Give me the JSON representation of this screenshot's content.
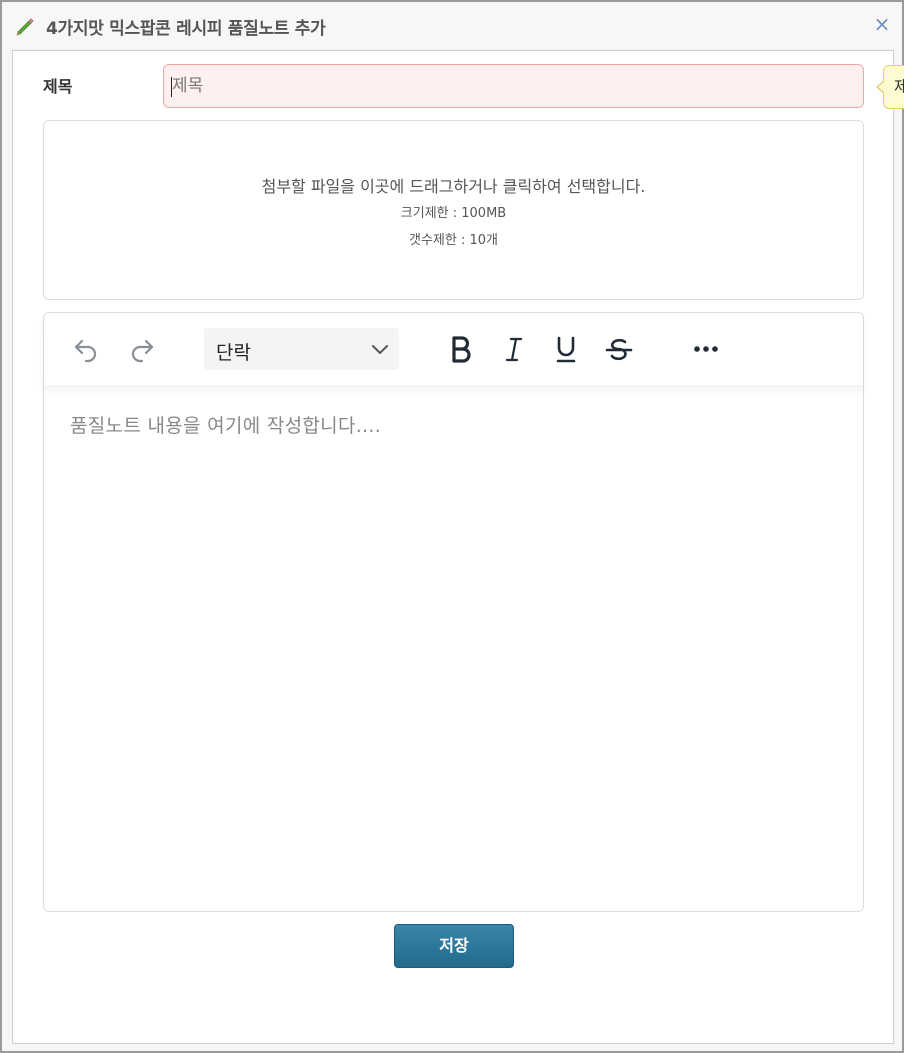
{
  "dialog": {
    "title": "4가지맛 믹스팝콘 레시피 품질노트 추가",
    "close_label": "×"
  },
  "form": {
    "title_label": "제목",
    "title_placeholder": "제목",
    "title_value": "",
    "tooltip_text": "제"
  },
  "dropzone": {
    "main_text": "첨부할 파일을 이곳에 드래그하거나 클릭하여 선택합니다.",
    "size_limit": "크기제한 : 100MB",
    "count_limit": "갯수제한 : 10개"
  },
  "editor": {
    "block_format": "단락",
    "placeholder": "품질노트 내용을 여기에 작성합니다....",
    "toolbar_icons": [
      "undo-icon",
      "redo-icon",
      "bold-icon",
      "italic-icon",
      "underline-icon",
      "strikethrough-icon",
      "more-icon"
    ]
  },
  "footer": {
    "save_label": "저장"
  },
  "colors": {
    "accent": "#2a7596",
    "input_error_bg": "#fff0f0",
    "input_error_border": "#f0a5a5",
    "tooltip_bg": "#fffbd0",
    "close_icon": "#6d8fbd",
    "pencil_icon": "#4a9a2e"
  }
}
